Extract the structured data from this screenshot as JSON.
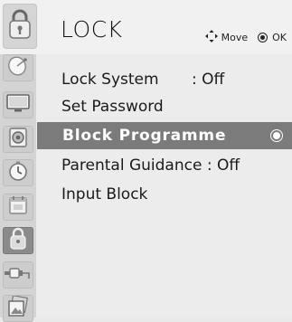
{
  "header": {
    "title": "LOCK",
    "hint_move": "Move",
    "hint_ok": "OK",
    "icon": "lock-icon"
  },
  "sidebar": {
    "items": [
      {
        "icon": "satellite-dish-icon"
      },
      {
        "icon": "tv-screen-icon"
      },
      {
        "icon": "speaker-icon"
      },
      {
        "icon": "clock-icon"
      },
      {
        "icon": "calendar-icon"
      },
      {
        "icon": "lock-icon",
        "active": true
      },
      {
        "icon": "cable-plug-icon"
      },
      {
        "icon": "photo-icon"
      }
    ]
  },
  "menu": {
    "items": [
      {
        "label": "Lock System",
        "value": ": Off"
      },
      {
        "label": "Set Password",
        "value": ""
      },
      {
        "label": "Block Programme",
        "value": "",
        "selected": true
      },
      {
        "label": "Parental Guidance : Off",
        "value": ""
      },
      {
        "label": "Input Block",
        "value": ""
      }
    ]
  },
  "colors": {
    "selected_row": "#7b7b7b",
    "sidebar": "#d4d4d4",
    "background": "#ececec"
  }
}
